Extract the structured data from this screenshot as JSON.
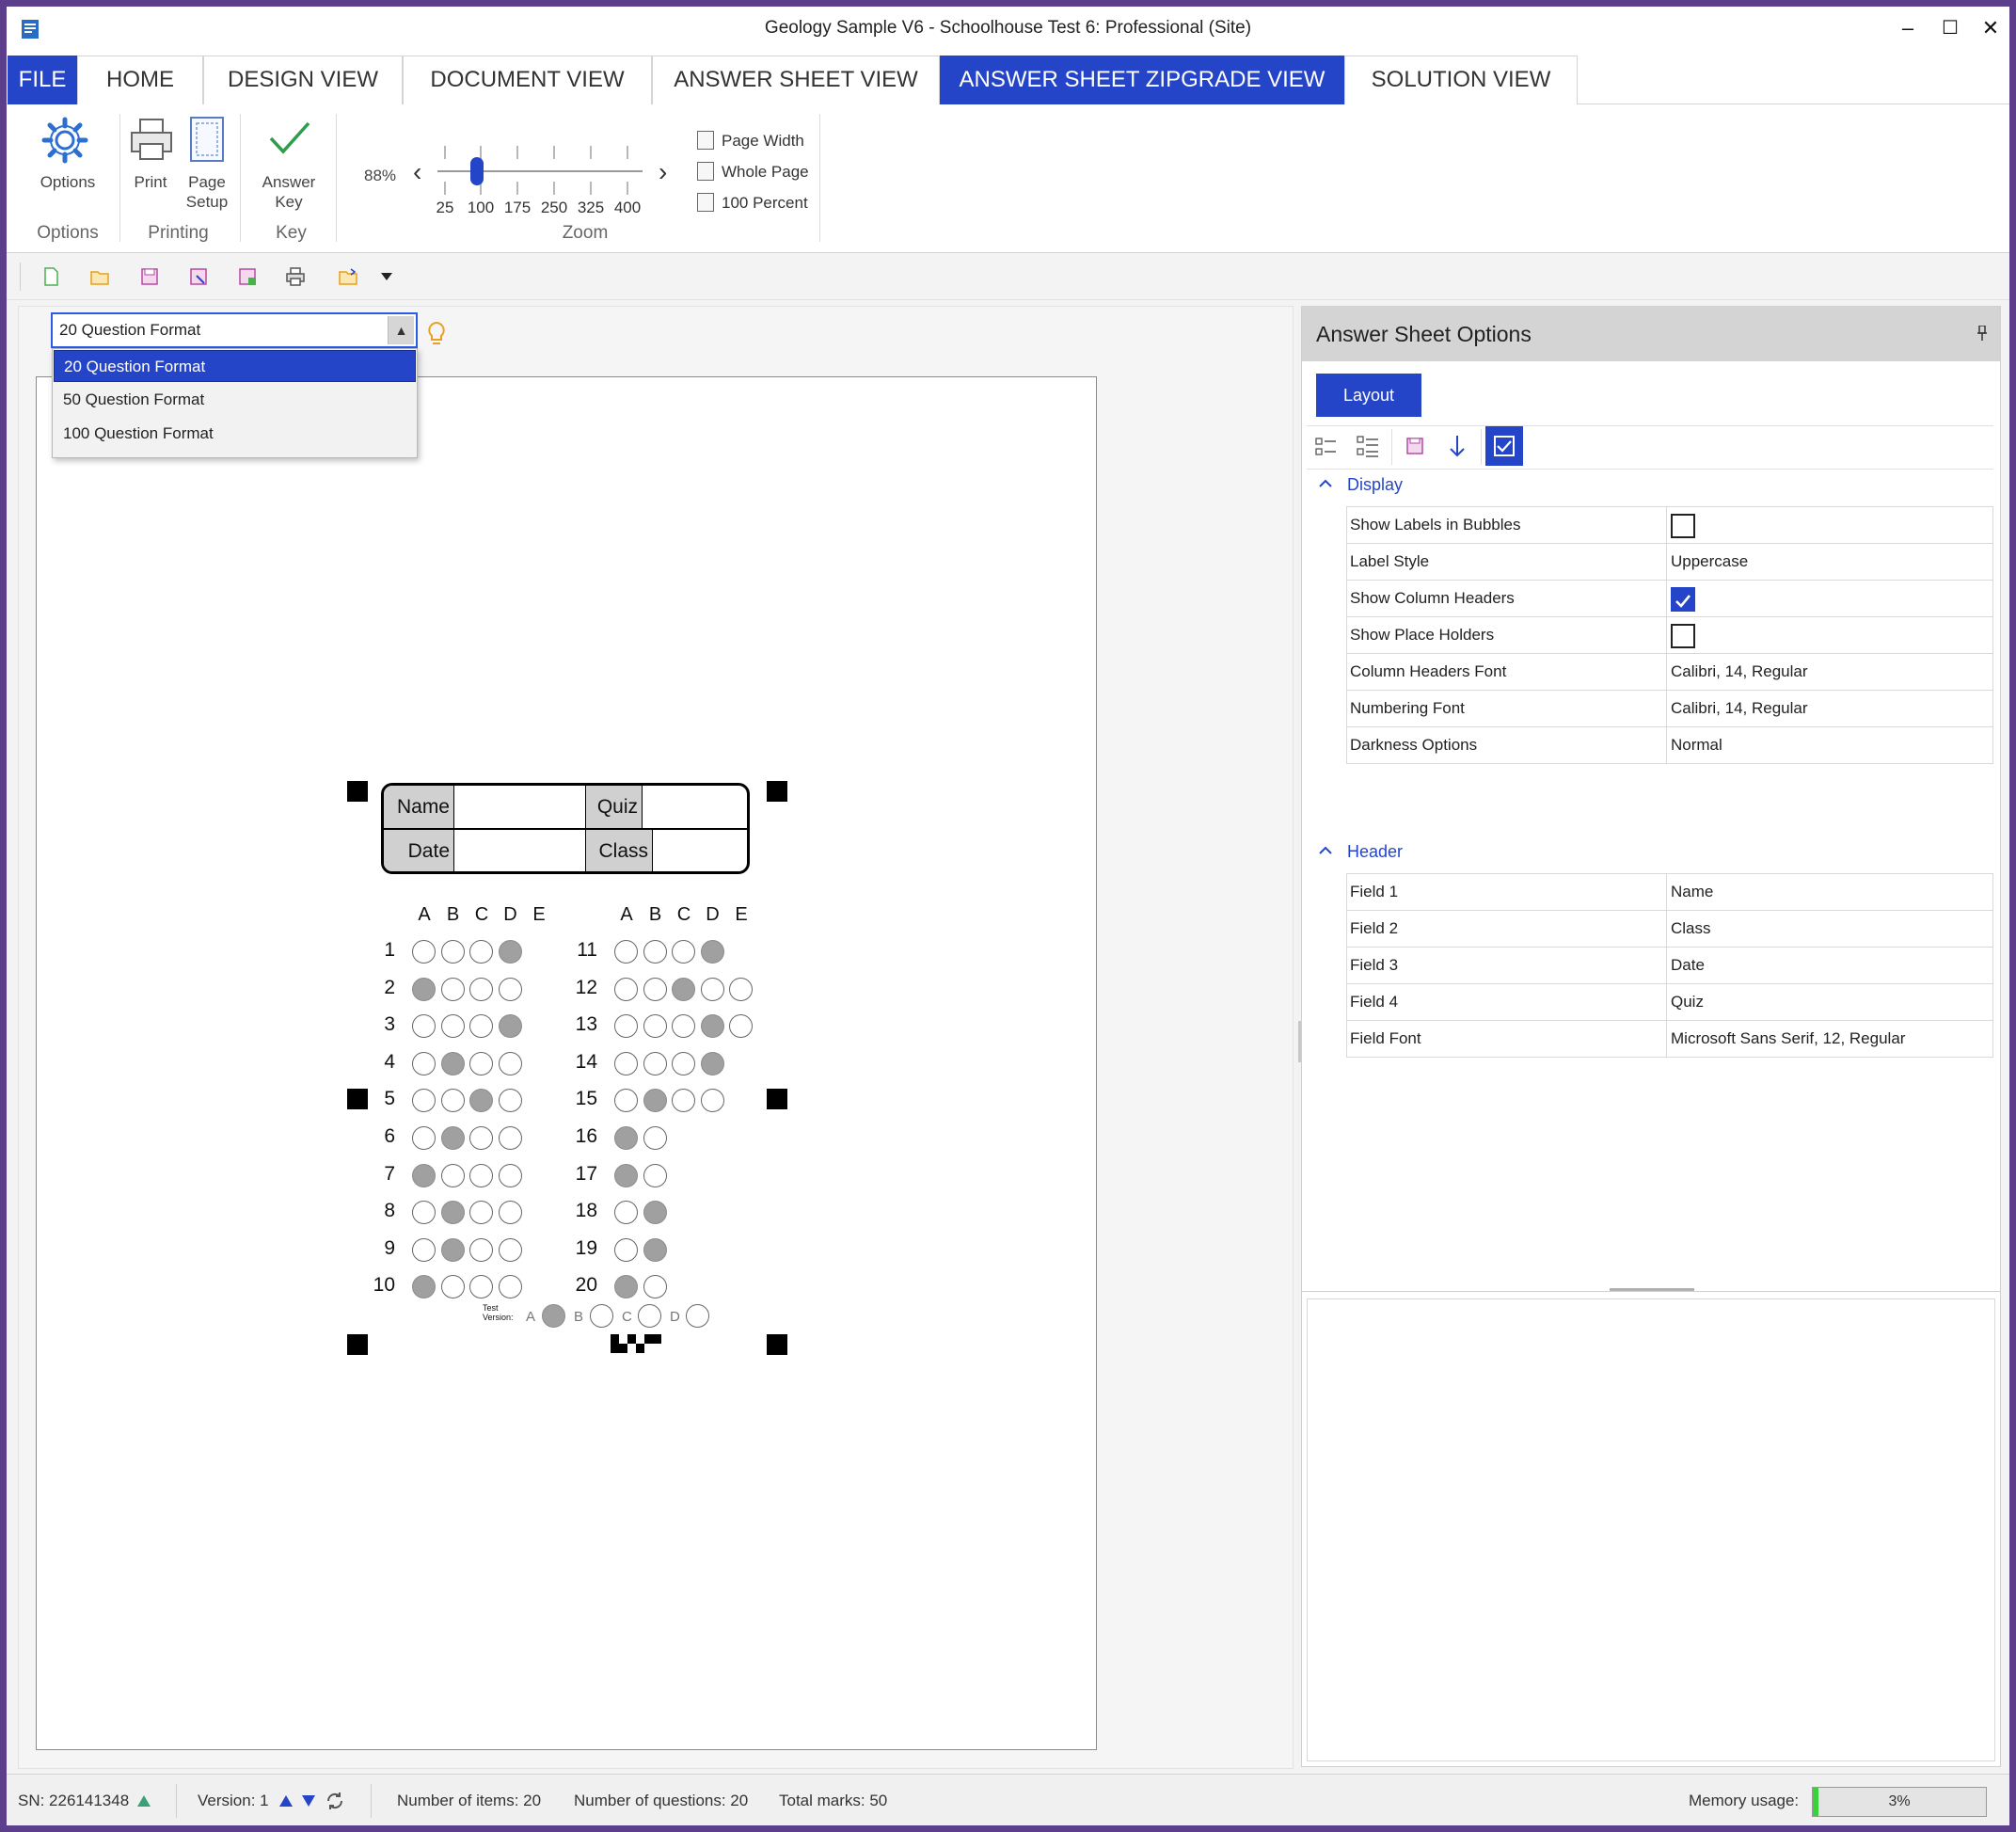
{
  "window": {
    "title": "Geology Sample V6 - Schoolhouse Test 6: Professional (Site)",
    "controls": [
      "–",
      "☐",
      "✕"
    ]
  },
  "tabs": [
    {
      "label": "FILE",
      "active": false
    },
    {
      "label": "HOME",
      "active": false
    },
    {
      "label": "DESIGN VIEW",
      "active": false
    },
    {
      "label": "DOCUMENT VIEW",
      "active": false
    },
    {
      "label": "ANSWER SHEET VIEW",
      "active": false
    },
    {
      "label": "ANSWER SHEET ZIPGRADE VIEW",
      "active": true
    },
    {
      "label": "SOLUTION VIEW",
      "active": false
    }
  ],
  "ribbon": {
    "options_button": "Options",
    "print_button": "Print",
    "page_setup_button": [
      "Page",
      "Setup"
    ],
    "answer_key_button": [
      "Answer",
      "Key"
    ],
    "group_options": "Options",
    "group_printing": "Printing",
    "group_key": "Key",
    "group_zoom": "Zoom",
    "zoom_percent": "88%",
    "zoom_level": 88,
    "zoom_ticks": [
      "25",
      "100",
      "175",
      "250",
      "325",
      "400"
    ],
    "page_width": "Page Width",
    "whole_page": "Whole Page",
    "hundred_percent": "100 Percent"
  },
  "quick_access": [
    "new-file-icon",
    "open-folder-icon",
    "save-icon",
    "save-as-icon",
    "save-copy-icon",
    "print-icon",
    "open-recent-icon",
    "customize-dropdown-icon"
  ],
  "format_selector": {
    "value": "20 Question Format",
    "options": [
      "20 Question Format",
      "50 Question Format",
      "100 Question Format"
    ],
    "selected_index": 0
  },
  "answer_sheet": {
    "header_fields": {
      "name": "Name",
      "quiz": "Quiz",
      "date": "Date",
      "class": "Class"
    },
    "column_headers": [
      "A",
      "B",
      "C",
      "D",
      "E"
    ],
    "left_questions": [
      {
        "n": "1",
        "fill": [
          0,
          0,
          0,
          1
        ]
      },
      {
        "n": "2",
        "fill": [
          1,
          0,
          0,
          0
        ]
      },
      {
        "n": "3",
        "fill": [
          0,
          0,
          0,
          1
        ]
      },
      {
        "n": "4",
        "fill": [
          0,
          1,
          0,
          0
        ]
      },
      {
        "n": "5",
        "fill": [
          0,
          0,
          1,
          0
        ]
      },
      {
        "n": "6",
        "fill": [
          0,
          1,
          0,
          0
        ]
      },
      {
        "n": "7",
        "fill": [
          1,
          0,
          0,
          0
        ]
      },
      {
        "n": "8",
        "fill": [
          0,
          1,
          0,
          0
        ]
      },
      {
        "n": "9",
        "fill": [
          0,
          1,
          0,
          0
        ]
      },
      {
        "n": "10",
        "fill": [
          1,
          0,
          0,
          0
        ]
      }
    ],
    "right_questions": [
      {
        "n": "11",
        "fill": [
          0,
          0,
          0,
          1
        ]
      },
      {
        "n": "12",
        "fill": [
          0,
          0,
          1,
          0,
          0
        ]
      },
      {
        "n": "13",
        "fill": [
          0,
          0,
          0,
          1,
          0
        ]
      },
      {
        "n": "14",
        "fill": [
          0,
          0,
          0,
          1
        ]
      },
      {
        "n": "15",
        "fill": [
          0,
          1,
          0,
          0
        ]
      },
      {
        "n": "16",
        "fill": [
          1,
          0
        ]
      },
      {
        "n": "17",
        "fill": [
          1,
          0
        ]
      },
      {
        "n": "18",
        "fill": [
          0,
          1
        ]
      },
      {
        "n": "19",
        "fill": [
          0,
          1
        ]
      },
      {
        "n": "20",
        "fill": [
          1,
          0
        ]
      }
    ],
    "test_version_label": [
      "Test",
      "Version:"
    ],
    "test_versions": [
      {
        "label": "A",
        "filled": true
      },
      {
        "label": "B",
        "filled": false
      },
      {
        "label": "C",
        "filled": false
      },
      {
        "label": "D",
        "filled": false
      }
    ]
  },
  "options_panel": {
    "title": "Answer Sheet Options",
    "layout_tab": "Layout",
    "display_section": "Display",
    "display_rows": [
      {
        "key": "Show Labels in Bubbles",
        "type": "checkbox",
        "checked": false
      },
      {
        "key": "Label Style",
        "type": "text",
        "value": "Uppercase"
      },
      {
        "key": "Show Column Headers",
        "type": "checkbox",
        "checked": true
      },
      {
        "key": "Show Place Holders",
        "type": "checkbox",
        "checked": false
      },
      {
        "key": "Column Headers Font",
        "type": "text",
        "value": "Calibri, 14, Regular"
      },
      {
        "key": "Numbering Font",
        "type": "text",
        "value": "Calibri, 14, Regular"
      },
      {
        "key": "Darkness Options",
        "type": "text",
        "value": "Normal"
      }
    ],
    "header_section": "Header",
    "header_rows": [
      {
        "key": "Field 1",
        "value": "Name"
      },
      {
        "key": "Field 2",
        "value": "Class"
      },
      {
        "key": "Field 3",
        "value": "Date"
      },
      {
        "key": "Field 4",
        "value": "Quiz"
      },
      {
        "key": "Field Font",
        "value": "Microsoft Sans Serif, 12, Regular"
      }
    ]
  },
  "status_bar": {
    "sn": "SN:  226141348",
    "version": "Version: 1",
    "items": "Number of items: 20",
    "questions": "Number of questions: 20",
    "marks": "Total marks: 50",
    "memory_label": "Memory usage:",
    "memory_pct": "3%",
    "memory_value": 3
  },
  "colors": {
    "accent": "#2545c8",
    "frame": "#5b3f8c",
    "bubble_fill": "#a0a0a0",
    "memory_bar": "#3ad23a"
  }
}
